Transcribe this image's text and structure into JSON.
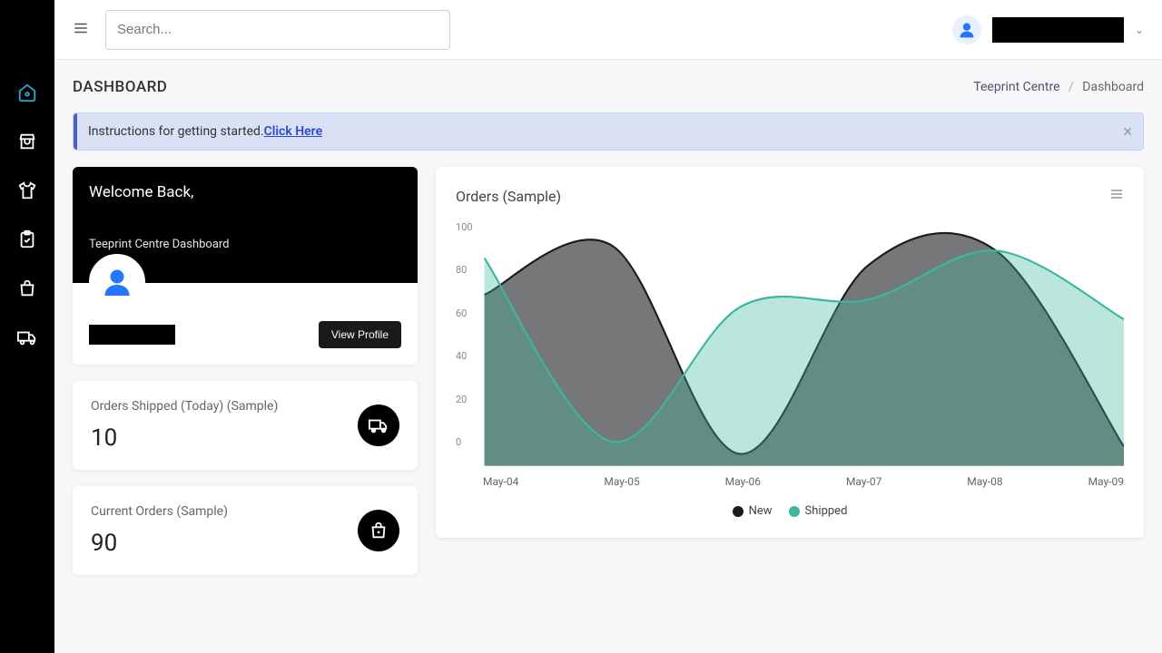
{
  "header": {
    "search_placeholder": "Search..."
  },
  "page": {
    "title": "DASHBOARD",
    "breadcrumb_root": "Teeprint Centre",
    "breadcrumb_current": "Dashboard"
  },
  "alert": {
    "text": "Instructions for getting started. ",
    "link_text": "Click Here"
  },
  "welcome": {
    "title": "Welcome Back,",
    "subtitle": "Teeprint Centre Dashboard",
    "view_profile_label": "View Profile"
  },
  "stats": {
    "shipped": {
      "label": "Orders Shipped (Today) (Sample)",
      "value": "10"
    },
    "current": {
      "label": "Current Orders (Sample)",
      "value": "90"
    }
  },
  "chart": {
    "title": "Orders (Sample)",
    "legend_new": "New",
    "legend_shipped": "Shipped"
  },
  "chart_data": {
    "type": "area",
    "categories": [
      "May-04",
      "May-05",
      "May-06",
      "May-07",
      "May-08",
      "May-09"
    ],
    "ylim": [
      0,
      100
    ],
    "y_ticks": [
      0,
      20,
      40,
      60,
      80,
      100
    ],
    "series": [
      {
        "name": "New",
        "color": "#1a1d1f",
        "values": [
          70,
          90,
          5,
          82,
          88,
          8
        ]
      },
      {
        "name": "Shipped",
        "color": "#3bb79d",
        "values": [
          85,
          10,
          65,
          68,
          88,
          60
        ]
      }
    ]
  },
  "colors": {
    "accent": "#2da6c9",
    "alert_bg": "#dbe1f5",
    "chart_new": "#1a1d1f",
    "chart_shipped": "#3bb79d"
  }
}
